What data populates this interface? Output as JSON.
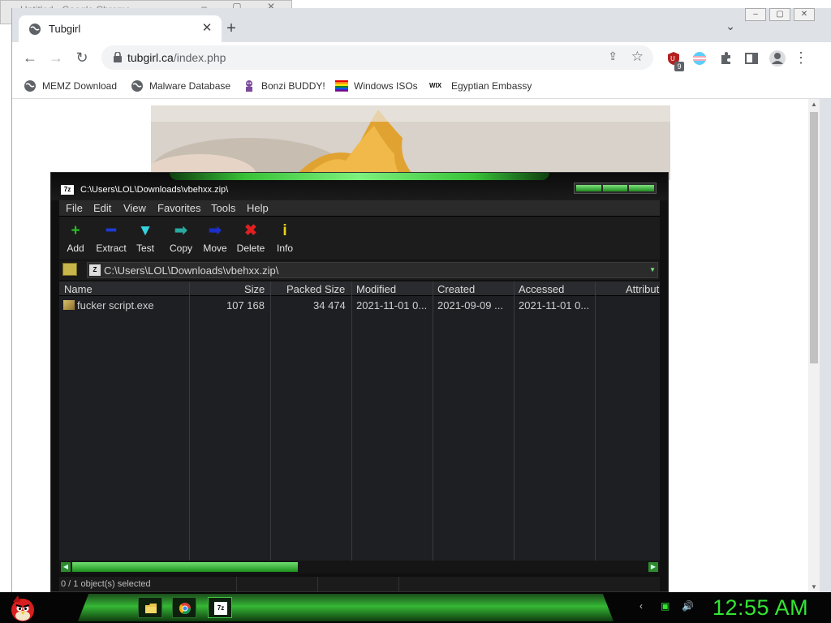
{
  "background_window": {
    "title": "Untitled - Google Chrome",
    "controls": "– ▢ ✕"
  },
  "chrome": {
    "tab": {
      "title": "Tubgirl",
      "close": "✕"
    },
    "new_tab": "+",
    "tab_search": "⌄",
    "window_controls": [
      "–",
      "▢",
      "✕"
    ],
    "nav": {
      "back": "←",
      "forward": "→",
      "reload": "↻"
    },
    "omnibox": {
      "domain": "tubgirl.ca",
      "path": "/index.php",
      "share": "⇪",
      "star": "☆"
    },
    "extension_badge": "9",
    "menu": "⋮",
    "bookmarks": [
      {
        "label": "MEMZ Download",
        "icon": "globe-icon"
      },
      {
        "label": "Malware Database",
        "icon": "globe-icon"
      },
      {
        "label": "Bonzi BUDDY!",
        "icon": "bonzi-icon"
      },
      {
        "label": "Windows ISOs",
        "icon": "windows-icon"
      },
      {
        "label": "Egyptian Embassy",
        "icon": "wix-icon"
      }
    ],
    "bookmark_wix_text": "WIX"
  },
  "sevenzip": {
    "app_icon": "7z",
    "title": "C:\\Users\\LOL\\Downloads\\vbehxx.zip\\",
    "menus": [
      "File",
      "Edit",
      "View",
      "Favorites",
      "Tools",
      "Help"
    ],
    "tools": [
      {
        "label": "Add",
        "glyph": "+",
        "color": "#22c422"
      },
      {
        "label": "Extract",
        "glyph": "━",
        "color": "#1e3bd6"
      },
      {
        "label": "Test",
        "glyph": "▼",
        "color": "#35d3e0"
      },
      {
        "label": "Copy",
        "glyph": "➡",
        "color": "#2aa9a0"
      },
      {
        "label": "Move",
        "glyph": "➡",
        "color": "#1a2fc7"
      },
      {
        "label": "Delete",
        "glyph": "✖",
        "color": "#e02020"
      },
      {
        "label": "Info",
        "glyph": "i",
        "color": "#e8d21c"
      }
    ],
    "address": "C:\\Users\\LOL\\Downloads\\vbehxx.zip\\",
    "address_zip_icon": "Z",
    "address_arrow": "▼",
    "columns": [
      "Name",
      "Size",
      "Packed Size",
      "Modified",
      "Created",
      "Accessed",
      "Attribut"
    ],
    "files": [
      {
        "name": "fucker script.exe",
        "size": "107 168",
        "packed": "34 474",
        "modified": "2021-11-01 0...",
        "created": "2021-09-09 ...",
        "accessed": "2021-11-01 0..."
      }
    ],
    "scroll_left": "◀",
    "scroll_right": "▶",
    "status": "0 / 1 object(s) selected"
  },
  "taskbar": {
    "explorer_icon": "folder-icon",
    "chrome_icon": "chrome-icon",
    "sevenzip_icon": "7z",
    "tray": [
      "‹",
      "▣",
      "🔊"
    ],
    "clock": "12:55 AM"
  }
}
